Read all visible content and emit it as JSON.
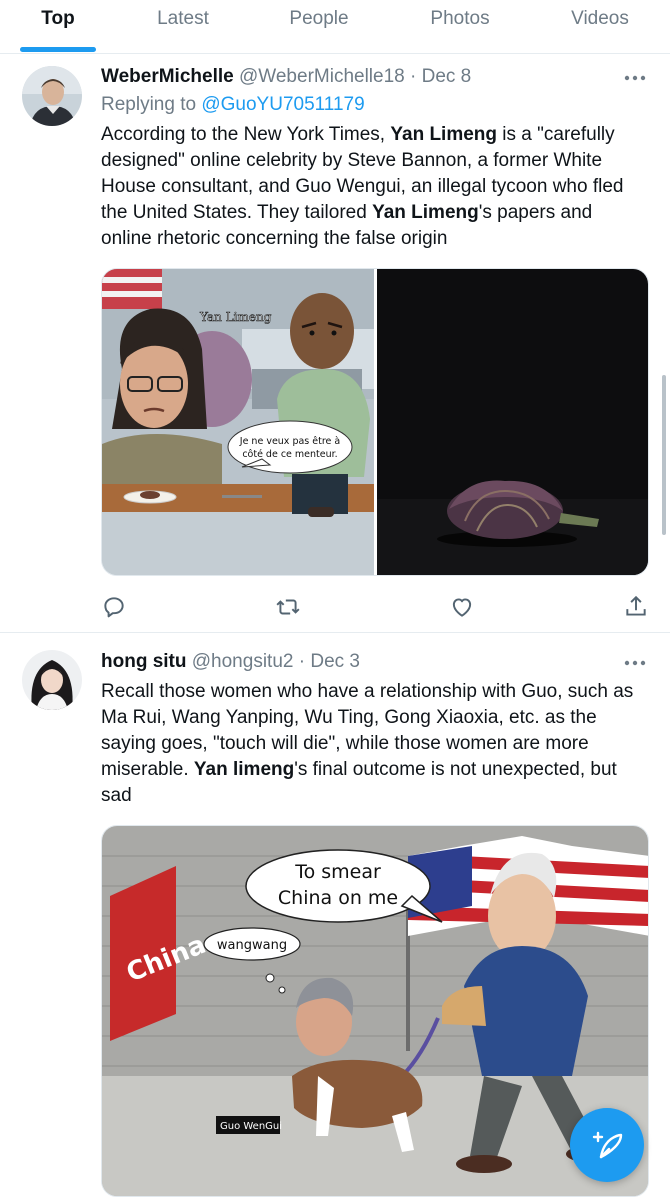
{
  "tabs": [
    {
      "label": "Top",
      "active": true
    },
    {
      "label": "Latest",
      "active": false
    },
    {
      "label": "People",
      "active": false
    },
    {
      "label": "Photos",
      "active": false
    },
    {
      "label": "Videos",
      "active": false
    }
  ],
  "tweets": [
    {
      "display_name": "WeberMichelle",
      "handle": "@WeberMichelle18",
      "separator": "·",
      "date": "Dec 8",
      "replying_prefix": "Replying to",
      "replying_handle": "@GuoYU70511179",
      "text_parts": [
        "According to the New York Times, ",
        "Yan Limeng",
        " is a \"carefully designed\" online celebrity by Steve Bannon, a former White House consultant, and Guo Wengui, an illegal tycoon who fled the United States. They tailored ",
        "Yan Limeng",
        "'s papers and online rhetoric concerning the false origin"
      ],
      "media": {
        "cartoon_name_label": "Yan Limeng",
        "speech_bubble": "Je ne veux pas être à côté de ce menteur."
      }
    },
    {
      "display_name": "hong situ",
      "handle": "@hongsitu2",
      "separator": "·",
      "date": "Dec 3",
      "text_parts": [
        "Recall those women who have a relationship with Guo, such as Ma Rui, Wang Yanping, Wu Ting, Gong Xiaoxia, etc. as the saying goes, \"touch will die\", while those women are more miserable. ",
        "Yan limeng",
        "'s final outcome is not unexpected, but sad"
      ],
      "media": {
        "speech_bubble": "To smear China on me",
        "wall_sign": "China",
        "dog_bubble": "wangwang",
        "name_tag": "Guo WenGui"
      }
    }
  ],
  "icons": {
    "more": "more-horizontal-icon",
    "reply": "reply-icon",
    "retweet": "retweet-icon",
    "like": "heart-icon",
    "share": "share-icon",
    "compose": "compose-tweet-icon"
  },
  "colors": {
    "accent": "#1d9bf0",
    "text": "#0f1419",
    "muted": "#6e7b86",
    "divider": "#e6ecf0"
  }
}
